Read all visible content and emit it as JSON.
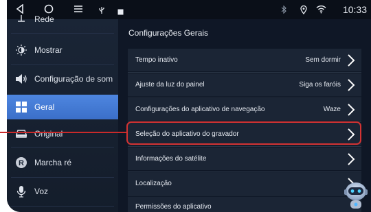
{
  "status_bar": {
    "back_icon": "triangle-back-icon",
    "home_icon": "circle-home-icon",
    "menu_icon": "hamburger-menu-icon",
    "usb_icon": "usb-icon",
    "image_icon": "image-icon",
    "bluetooth_icon": "bluetooth-icon",
    "location_icon": "location-icon",
    "wifi_icon": "wifi-icon",
    "time": "10:33"
  },
  "sidebar": {
    "items": [
      {
        "label": "Rede",
        "icon": "network-icon"
      },
      {
        "label": "Mostrar",
        "icon": "brightness-icon"
      },
      {
        "label": "Configuração de som",
        "icon": "speaker-icon"
      },
      {
        "label": "Geral",
        "icon": "grid-icon",
        "active": true
      },
      {
        "label": "Original",
        "icon": "car-icon"
      },
      {
        "label": "Marcha ré",
        "icon": "reverse-r-icon"
      },
      {
        "label": "Voz",
        "icon": "microphone-icon"
      }
    ]
  },
  "main": {
    "title": "Configurações Gerais",
    "rows": [
      {
        "label": "Tempo inativo",
        "value": "Sem dormir"
      },
      {
        "label": "Ajuste da luz do painel",
        "value": "Siga os faróis"
      },
      {
        "label": "Configurações do aplicativo de navegação",
        "value": "Waze"
      },
      {
        "label": "Seleção do aplicativo do gravador",
        "value": ""
      },
      {
        "label": "Informações do satélite",
        "value": ""
      },
      {
        "label": "Localização",
        "value": ""
      },
      {
        "label": "Permissões do aplicativo",
        "value": ""
      }
    ]
  },
  "colors": {
    "accent": "#4a82dc",
    "highlight": "#d43333",
    "background": "#0f1726"
  }
}
